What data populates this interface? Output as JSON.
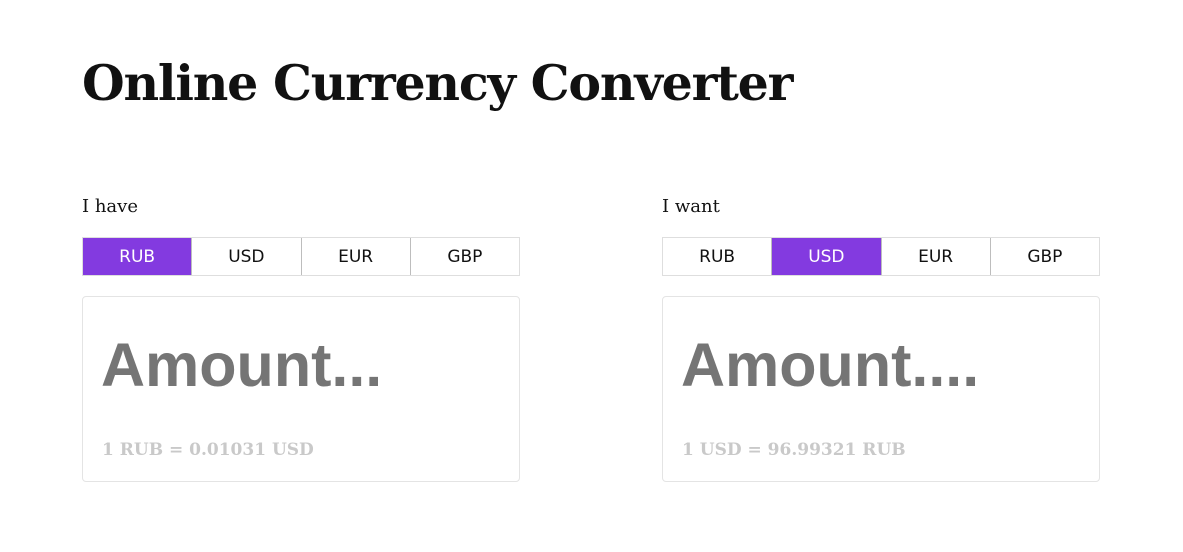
{
  "page": {
    "title": "Online Currency Converter"
  },
  "colors": {
    "accent": "#833ae0",
    "placeholder": "#757575",
    "rate_text": "#c9c9c9",
    "border": "#dedede"
  },
  "have": {
    "label": "I have",
    "tabs": [
      {
        "label": "RUB",
        "active": true
      },
      {
        "label": "USD",
        "active": false
      },
      {
        "label": "EUR",
        "active": false
      },
      {
        "label": "GBP",
        "active": false
      }
    ],
    "amount_value": "",
    "amount_placeholder": "Amount...",
    "rate": "1 RUB = 0.01031 USD"
  },
  "want": {
    "label": "I want",
    "tabs": [
      {
        "label": "RUB",
        "active": false
      },
      {
        "label": "USD",
        "active": true
      },
      {
        "label": "EUR",
        "active": false
      },
      {
        "label": "GBP",
        "active": false
      }
    ],
    "amount_value": "",
    "amount_placeholder": "Amount....",
    "rate": "1 USD = 96.99321 RUB"
  }
}
